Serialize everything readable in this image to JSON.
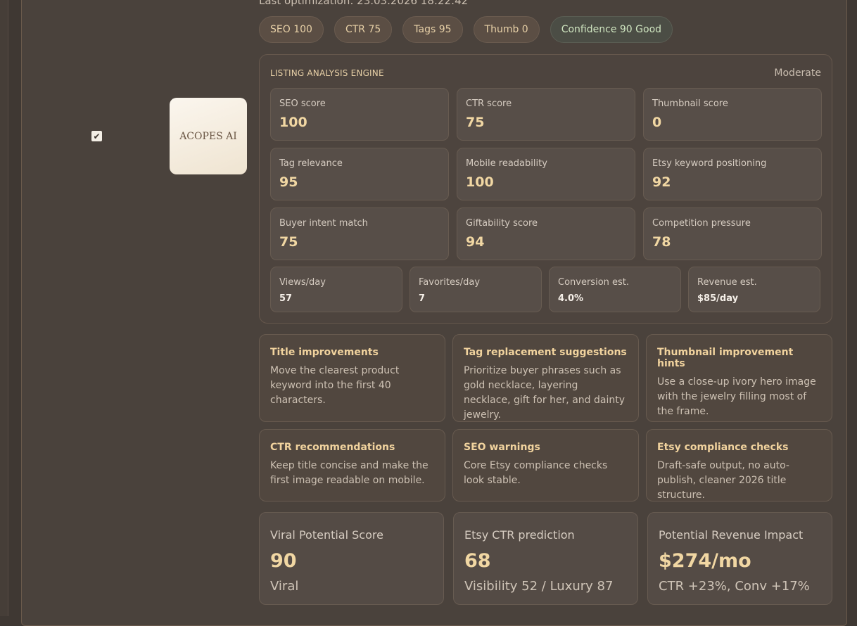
{
  "header": {
    "last_optimization": "Last optimization: 23.03.2026 18:22:42"
  },
  "badges": [
    {
      "label": "SEO 100"
    },
    {
      "label": "CTR 75"
    },
    {
      "label": "Tags 95"
    },
    {
      "label": "Thumb 0"
    },
    {
      "label": "Confidence 90 Good"
    }
  ],
  "listing": {
    "checked": true,
    "thumbnail_text": "ACOPES AI"
  },
  "engine": {
    "title": "LISTING ANALYSIS ENGINE",
    "level": "Moderate",
    "metrics": [
      {
        "label": "SEO score",
        "value": "100"
      },
      {
        "label": "CTR score",
        "value": "75"
      },
      {
        "label": "Thumbnail score",
        "value": "0"
      },
      {
        "label": "Tag relevance",
        "value": "95"
      },
      {
        "label": "Mobile readability",
        "value": "100"
      },
      {
        "label": "Etsy keyword positioning",
        "value": "92"
      },
      {
        "label": "Buyer intent match",
        "value": "75"
      },
      {
        "label": "Giftability score",
        "value": "94"
      },
      {
        "label": "Competition pressure",
        "value": "78"
      }
    ],
    "stats": [
      {
        "label": "Views/day",
        "value": "57"
      },
      {
        "label": "Favorites/day",
        "value": "7"
      },
      {
        "label": "Conversion est.",
        "value": "4.0%"
      },
      {
        "label": "Revenue est.",
        "value": "$85/day"
      }
    ]
  },
  "tips": [
    {
      "title": "Title improvements",
      "body": "Move the clearest product keyword into the first 40 characters."
    },
    {
      "title": "Tag replacement suggestions",
      "body": "Prioritize buyer phrases such as gold necklace, layering necklace, gift for her, and dainty jewelry."
    },
    {
      "title": "Thumbnail improvement hints",
      "body": "Use a close-up ivory hero image with the jewelry filling most of the frame."
    },
    {
      "title": "CTR recommendations",
      "body": "Keep title concise and make the first image readable on mobile."
    },
    {
      "title": "SEO warnings",
      "body": "Core Etsy compliance checks look stable."
    },
    {
      "title": "Etsy compliance checks",
      "body": "Draft-safe output, no auto-publish, cleaner 2026 title structure."
    }
  ],
  "summary": [
    {
      "label": "Viral Potential Score",
      "value": "90",
      "sub": "Viral"
    },
    {
      "label": "Etsy CTR prediction",
      "value": "68",
      "sub": "Visibility 52 / Luxury 87"
    },
    {
      "label": "Potential Revenue Impact",
      "value": "$274/mo",
      "sub": "CTR +23%, Conv +17%"
    }
  ]
}
